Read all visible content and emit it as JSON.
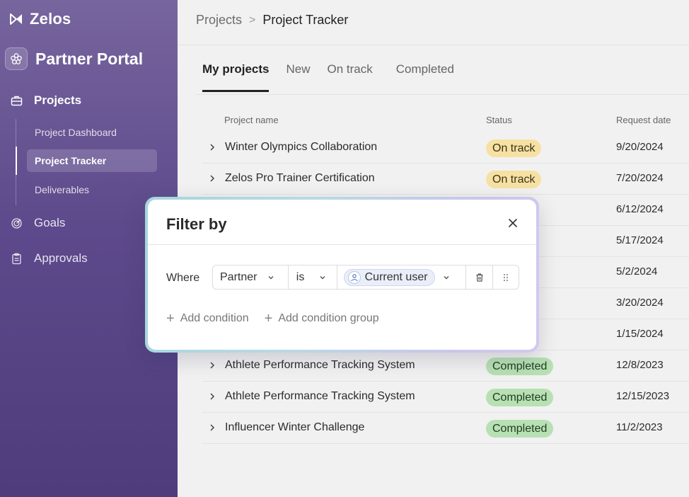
{
  "sidebar": {
    "brand": "Zelos",
    "portal": "Partner Portal",
    "nav": {
      "projects": "Projects",
      "goals": "Goals",
      "approvals": "Approvals"
    },
    "sub_items": [
      "Project Dashboard",
      "Project Tracker",
      "Deliverables"
    ],
    "active_sub": "Project Tracker"
  },
  "breadcrumb": {
    "parent": "Projects",
    "separator": ">",
    "current": "Project Tracker"
  },
  "tabs": [
    "My projects",
    "New",
    "On track",
    "Completed"
  ],
  "active_tab": "My projects",
  "table": {
    "columns": [
      "Project name",
      "Status",
      "Request date"
    ],
    "rows": [
      {
        "name": "Winter Olympics Collaboration",
        "status": "On track",
        "date": "9/20/2024"
      },
      {
        "name": "Zelos Pro Trainer Certification",
        "status": "On track",
        "date": "7/20/2024"
      },
      {
        "name": "",
        "status": "",
        "date": "6/12/2024"
      },
      {
        "name": "",
        "status": "",
        "date": "5/17/2024"
      },
      {
        "name": "",
        "status": "",
        "date": "5/2/2024"
      },
      {
        "name": "",
        "status": "",
        "date": "3/20/2024"
      },
      {
        "name": "",
        "status": "",
        "date": "1/15/2024"
      },
      {
        "name": "Athlete Performance Tracking System",
        "status": "Completed",
        "date": "12/8/2023"
      },
      {
        "name": "Athlete Performance Tracking System",
        "status": "Completed",
        "date": "12/15/2023"
      },
      {
        "name": "Influencer Winter Challenge",
        "status": "Completed",
        "date": "11/2/2023"
      }
    ]
  },
  "filter": {
    "title": "Filter by",
    "where_label": "Where",
    "field": "Partner",
    "operator": "is",
    "value": "Current user",
    "add_condition": "Add condition",
    "add_condition_group": "Add condition group"
  },
  "colors": {
    "sidebar_top": "#77659e",
    "sidebar_bottom": "#4e3c7c",
    "ontrack_badge": "#f6e1a3",
    "completed_badge": "#b7e0b3"
  }
}
